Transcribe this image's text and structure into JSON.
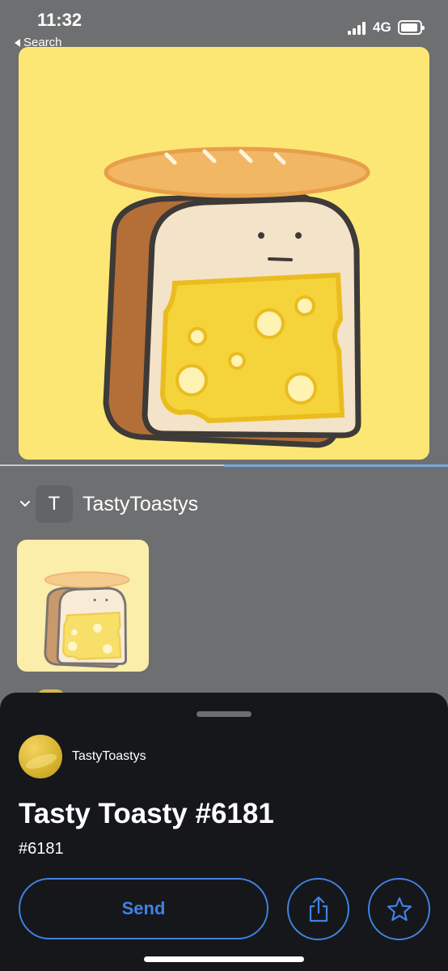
{
  "status_bar": {
    "time": "11:32",
    "back_label": "Search",
    "network": "4G"
  },
  "hero": {
    "background_color": "#fde774",
    "image": "bread-loaf-with-cheese-and-baguette-illustration"
  },
  "collection": {
    "avatar_letter": "T",
    "name": "TastyToastys",
    "chevron": "chevron-down-icon"
  },
  "sheet": {
    "creator_name": "TastyToastys",
    "title": "Tasty Toasty #6181",
    "subtitle": "#6181",
    "send_label": "Send",
    "share_icon": "share-icon",
    "favorite_icon": "star-icon"
  },
  "colors": {
    "accent": "#3f82e4",
    "sheet_background": "#16171a",
    "page_background": "#6e6f70"
  }
}
